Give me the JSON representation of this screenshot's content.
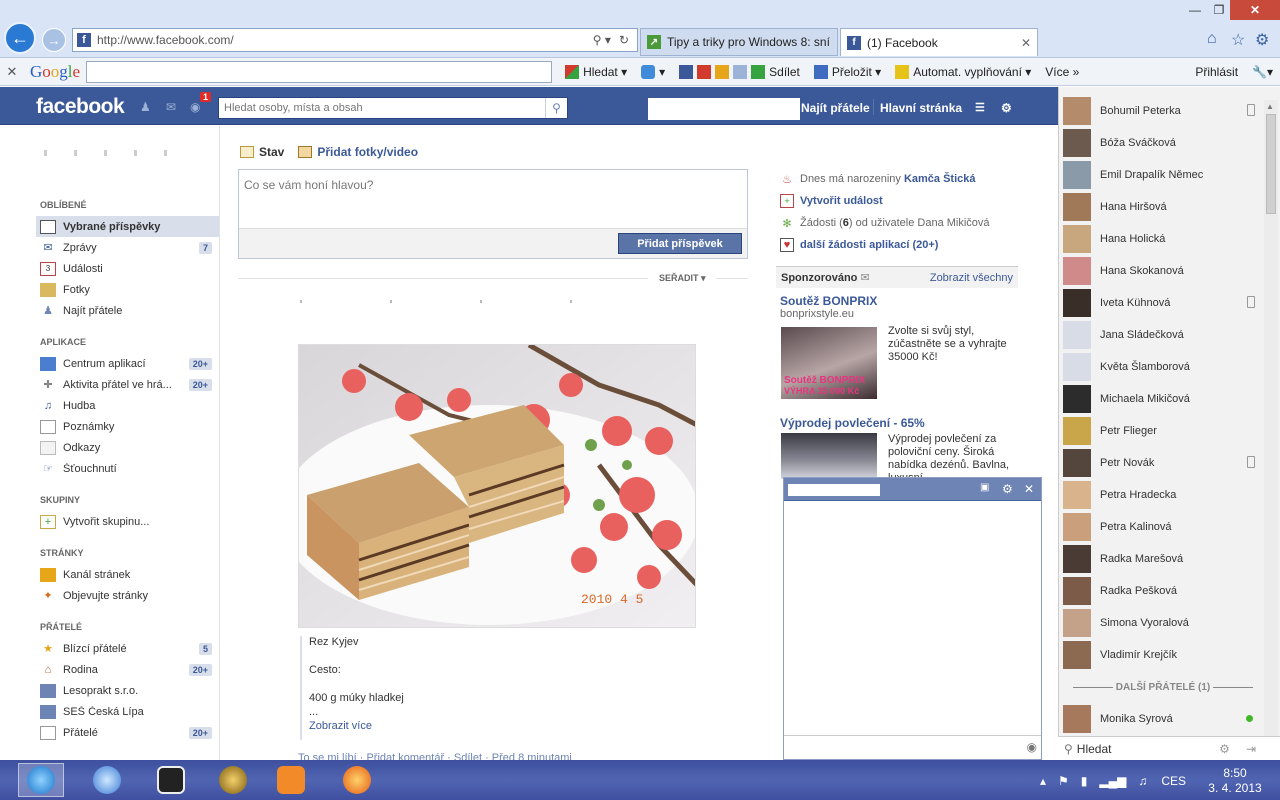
{
  "browser": {
    "url": "http://www.facebook.com/",
    "tabs": [
      {
        "label": "Tipy a triky pro Windows 8: sní..."
      },
      {
        "label": "(1) Facebook"
      }
    ]
  },
  "google_toolbar": {
    "logo": "Google",
    "search_label": "Hledat",
    "share_label": "Sdílet",
    "translate_label": "Přeložit",
    "autofill_label": "Automat. vyplňování",
    "more_label": "Více",
    "signin_label": "Přihlásit"
  },
  "facebook": {
    "logo": "facebook",
    "notif_count": "1",
    "search_placeholder": "Hledat osoby, místa a obsah",
    "find_friends": "Najít přátele",
    "home": "Hlavní stránka"
  },
  "left_nav": {
    "favorites_title": "OBLÍBENÉ",
    "favorites": [
      {
        "label": "Vybrané příspěvky",
        "count": ""
      },
      {
        "label": "Zprávy",
        "count": "7"
      },
      {
        "label": "Události",
        "count": ""
      },
      {
        "label": "Fotky",
        "count": ""
      },
      {
        "label": "Najít přátele",
        "count": ""
      }
    ],
    "apps_title": "APLIKACE",
    "apps": [
      {
        "label": "Centrum aplikací",
        "count": "20+"
      },
      {
        "label": "Aktivita přátel ve hrá...",
        "count": "20+"
      },
      {
        "label": "Hudba",
        "count": ""
      },
      {
        "label": "Poznámky",
        "count": ""
      },
      {
        "label": "Odkazy",
        "count": ""
      },
      {
        "label": "Šťouchnutí",
        "count": ""
      }
    ],
    "groups_title": "SKUPINY",
    "groups": [
      {
        "label": "Vytvořit skupinu...",
        "count": ""
      }
    ],
    "pages_title": "STRÁNKY",
    "pages": [
      {
        "label": "Kanál stránek",
        "count": ""
      },
      {
        "label": "Objevujte stránky",
        "count": ""
      }
    ],
    "friends_title": "PŘÁTELÉ",
    "friends": [
      {
        "label": "Blízcí přátelé",
        "count": "5"
      },
      {
        "label": "Rodina",
        "count": "20+"
      },
      {
        "label": "Lesoprakt s.r.o.",
        "count": ""
      },
      {
        "label": "SEŠ Česká Lípa",
        "count": ""
      },
      {
        "label": "Přátelé",
        "count": "20+"
      }
    ]
  },
  "composer": {
    "status_tab": "Stav",
    "photo_tab": "Přidat fotky/video",
    "placeholder": "Co se vám honí hlavou?",
    "post_button": "Přidat příspěvek",
    "sort_label": "SEŘADIT"
  },
  "post": {
    "photo_stamp": "2010  4  5",
    "lines": [
      "Rez Kyjev",
      "Cesto:",
      "400 g múky hladkej",
      "..."
    ],
    "more_link": "Zobrazit více",
    "actions": "To se mi líbí · Přidat komentář · Sdílet · Před 8 minutami"
  },
  "right_col": {
    "birthday_prefix": "Dnes má narozeniny",
    "birthday_name": "Kamča Štická",
    "create_event": "Vytvořit událost",
    "requests_prefix": "Žádosti (",
    "requests_count": "6",
    "requests_suffix": ") od uživatele Dana Mikičová",
    "more_app_requests": "další žádosti aplikací (20+)",
    "sponsored": "Sponzorováno",
    "show_all": "Zobrazit všechny",
    "ads": [
      {
        "title": "Soutěž BONPRIX",
        "host": "bonprixstyle.eu",
        "text": "Zvolte si svůj styl, zúčastněte se a vyhrajte 35000 Kč!",
        "img_caption1": "Soutěž BONPRIX",
        "img_caption2": "VÝHRA  35 000 Kč"
      },
      {
        "title": "Výprodej povlečení - 65%",
        "host": "",
        "text": "Výprodej povlečení za poloviční ceny. Široká nabídka dezénů. Bavlna, luxusní..."
      }
    ]
  },
  "sidebar": {
    "friends": [
      {
        "name": "Bohumil Peterka",
        "mobile": true,
        "color": "#b48c6c"
      },
      {
        "name": "Bóža Sváčková",
        "mobile": false,
        "color": "#6b5a4d"
      },
      {
        "name": "Emil Drapalík Němec",
        "mobile": false,
        "color": "#8a9aa8"
      },
      {
        "name": "Hana Hiršová",
        "mobile": false,
        "color": "#a07a58"
      },
      {
        "name": "Hana Holická",
        "mobile": false,
        "color": "#c9a77e"
      },
      {
        "name": "Hana Skokanová",
        "mobile": false,
        "color": "#cf8a8a"
      },
      {
        "name": "Iveta Kühnová",
        "mobile": true,
        "color": "#3a2e28"
      },
      {
        "name": "Jana Sládečková",
        "mobile": false,
        "color": "#d7dce6"
      },
      {
        "name": "Květa Šlamborová",
        "mobile": false,
        "color": "#d7dce6"
      },
      {
        "name": "Michaela Mikičová",
        "mobile": false,
        "color": "#2c2c2c"
      },
      {
        "name": "Petr Flieger",
        "mobile": false,
        "color": "#c9a64a"
      },
      {
        "name": "Petr Novák",
        "mobile": true,
        "color": "#55463d"
      },
      {
        "name": "Petra Hradecka",
        "mobile": false,
        "color": "#d9b38c"
      },
      {
        "name": "Petra Kalinová",
        "mobile": false,
        "color": "#caa07c"
      },
      {
        "name": "Radka Marešová",
        "mobile": false,
        "color": "#4a3b34"
      },
      {
        "name": "Radka Pešková",
        "mobile": false,
        "color": "#7c5c48"
      },
      {
        "name": "Simona Vyoralová",
        "mobile": false,
        "color": "#c4a28a"
      },
      {
        "name": "Vladimír Krejčík",
        "mobile": false,
        "color": "#8c6a52"
      }
    ],
    "more_friends_title": "DALŠÍ PŘÁTELÉ (1)",
    "more_friends": [
      {
        "name": "Monika Syrová",
        "online": true,
        "color": "#a6795c"
      }
    ],
    "search_label": "Hledat"
  },
  "taskbar": {
    "lang": "CES",
    "time": "8:50",
    "date": "3. 4. 2013"
  }
}
